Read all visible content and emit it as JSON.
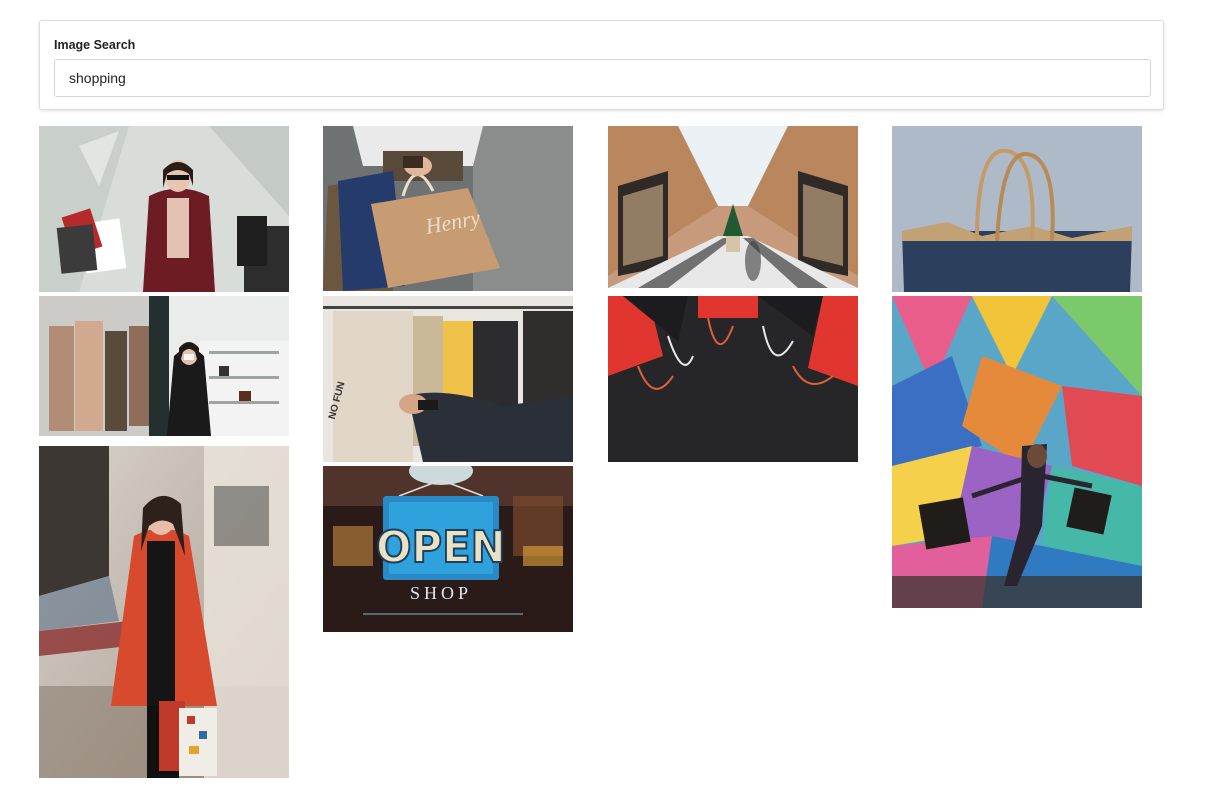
{
  "search": {
    "label": "Image Search",
    "value": "shopping"
  },
  "results": [
    {
      "name": "woman-with-shopping-bags"
    },
    {
      "name": "hand-holding-henry-bag",
      "bag_text": "Henry"
    },
    {
      "name": "shopping-arcade-interior"
    },
    {
      "name": "paper-bag-blue"
    },
    {
      "name": "woman-browsing-clothing-store"
    },
    {
      "name": "hands-on-clothing-rack",
      "shirt_text": "NO FUN"
    },
    {
      "name": "red-shopping-bags-flatlay"
    },
    {
      "name": "woman-dancing-colorful-mural"
    },
    {
      "name": "woman-red-coat-bags"
    },
    {
      "name": "open-shop-sign",
      "sign_text": "OPEN",
      "sign_subtext": "SHOP"
    }
  ]
}
